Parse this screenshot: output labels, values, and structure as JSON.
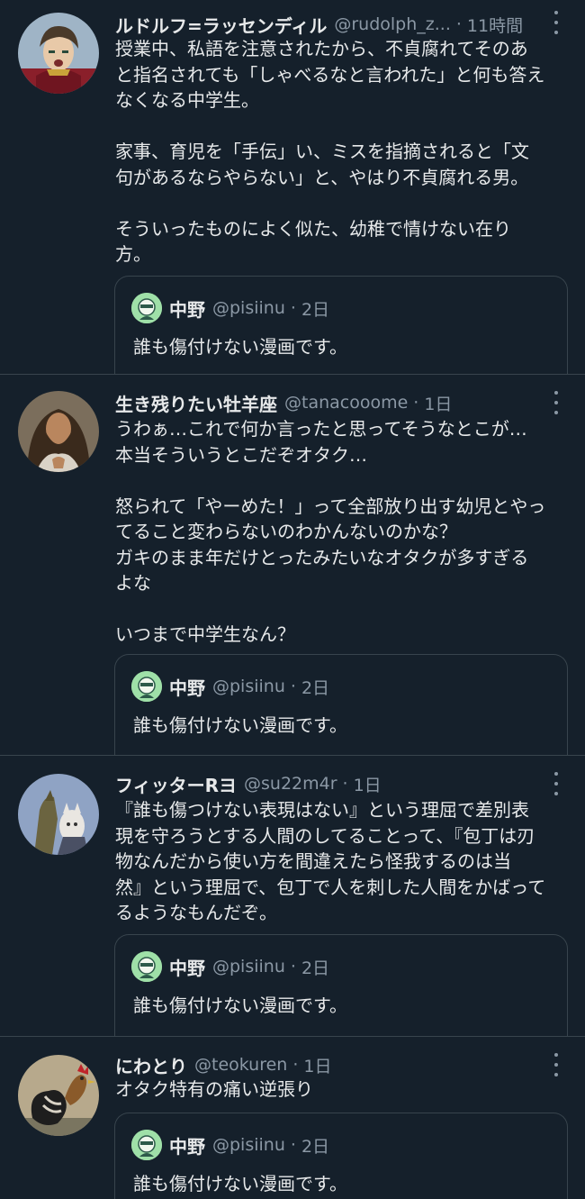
{
  "tweets": [
    {
      "name": "ルドルフ=ラッセンディル",
      "handle": "@rudolph_z...",
      "dot": "·",
      "time": "11時間",
      "text": "授業中、私語を注意されたから、不貞腐れてそのあ\nと指名されても「しゃべるなと言われた」と何も答え\nなくなる中学生。\n\n家事、育児を「手伝」い、ミスを指摘されると「文\n句があるならやらない」と、やはり不貞腐れる男。\n\nそういったものによく似た、幼稚で情けない在り\n方。",
      "quote": {
        "name": "中野",
        "handle": "@pisiinu",
        "dot": "·",
        "time": "2日",
        "text": "誰も傷付けない漫画です。"
      }
    },
    {
      "name": "生き残りたい牡羊座",
      "handle": "@tanacooome",
      "dot": "·",
      "time": "1日",
      "text": "うわぁ…これで何か言ったと思ってそうなとこが…\n本当そういうとこだぞオタク…\n\n怒られて「やーめた！」って全部放り出す幼児とやっ\nてること変わらないのわかんないのかな？\nガキのまま年だけとったみたいなオタクが多すぎる\nよな\n\nいつまで中学生なん？",
      "quote": {
        "name": "中野",
        "handle": "@pisiinu",
        "dot": "·",
        "time": "2日",
        "text": "誰も傷付けない漫画です。"
      }
    },
    {
      "name": "フィッターRヨ",
      "handle": "@su22m4r",
      "dot": "·",
      "time": "1日",
      "text": "『誰も傷つけない表現はない』という理屈で差別表\n現を守ろうとする人間のしてることって、『包丁は刃\n物なんだから使い方を間違えたら怪我するのは当\n然』という理屈で、包丁で人を刺した人間をかばって\nるようなもんだぞ。",
      "quote": {
        "name": "中野",
        "handle": "@pisiinu",
        "dot": "·",
        "time": "2日",
        "text": "誰も傷付けない漫画です。"
      }
    },
    {
      "name": "にわとり",
      "handle": "@teokuren",
      "dot": "·",
      "time": "1日",
      "text": "オタク特有の痛い逆張り",
      "quote": {
        "name": "中野",
        "handle": "@pisiinu",
        "dot": "·",
        "time": "2日",
        "text": "誰も傷付けない漫画です。"
      }
    }
  ]
}
